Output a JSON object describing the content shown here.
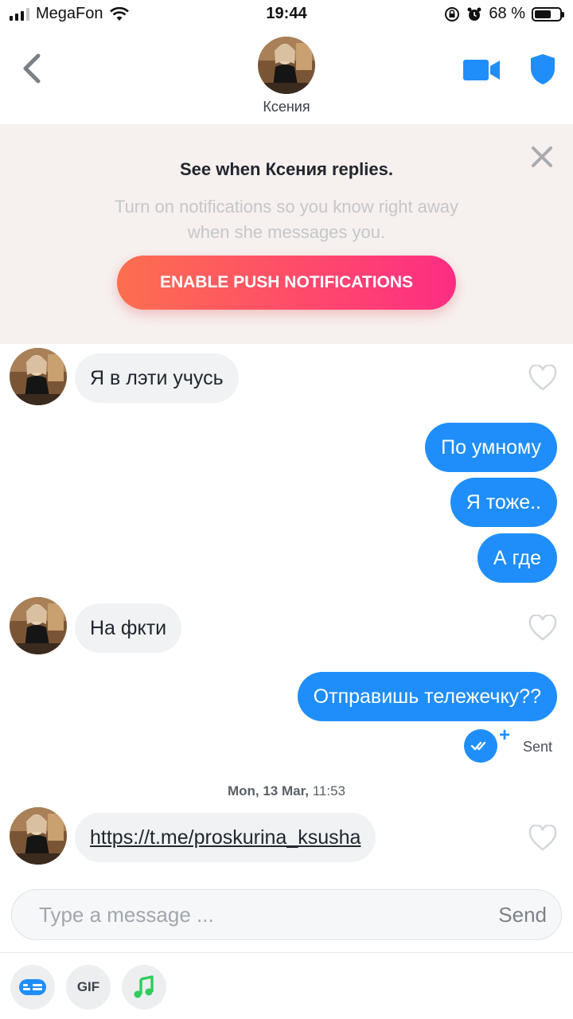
{
  "status_bar": {
    "carrier": "MegaFon",
    "time": "19:44",
    "battery": "68 %",
    "battery_level": 0.68
  },
  "header": {
    "contact_name": "Ксения"
  },
  "banner": {
    "title": "See when Ксения replies.",
    "text": "Turn on notifications so you know right away when she messages you.",
    "button_label": "ENABLE PUSH NOTIFICATIONS"
  },
  "messages": [
    {
      "direction": "in",
      "text": "Я в лэти учусь"
    },
    {
      "direction": "out",
      "text": "По умному"
    },
    {
      "direction": "out",
      "text": "Я тоже.."
    },
    {
      "direction": "out",
      "text": "А где"
    },
    {
      "direction": "in",
      "text": "На фкти"
    },
    {
      "direction": "out",
      "text": "Отправишь тележечку??"
    },
    {
      "direction": "in",
      "text": "https://t.me/proskurina_ksusha"
    }
  ],
  "sent_status": "Sent",
  "timestamp": {
    "date": "Mon, 13 Mar,",
    "time": "11:53"
  },
  "composer": {
    "placeholder": "Type a message ...",
    "send_label": "Send"
  },
  "toolbar": {
    "gif_label": "GIF"
  },
  "colors": {
    "accent_blue": "#1f8efa",
    "banner_bg": "#f6f0ee",
    "button_gradient_start": "#fd6f4f",
    "button_gradient_end": "#fd2d83",
    "music_green": "#2ecc5a"
  },
  "icons": [
    "back-chevron-icon",
    "video-call-icon",
    "safety-shield-icon",
    "close-icon",
    "heart-icon",
    "double-check-icon",
    "contact-card-icon",
    "music-note-icon"
  ]
}
